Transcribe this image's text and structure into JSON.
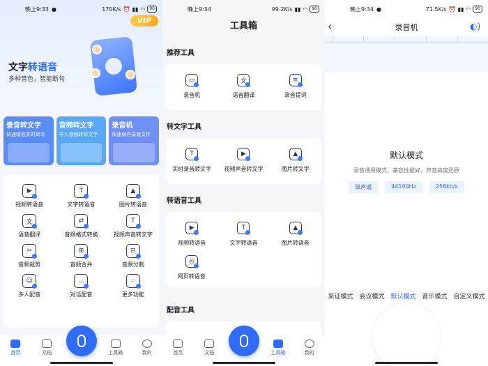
{
  "status1": {
    "time": "晚上9:33",
    "speed": "170K/s",
    "battery": "90"
  },
  "status2": {
    "time": "晚上9:34",
    "speed": "99.2K/s",
    "battery": "90"
  },
  "status3": {
    "time": "晚上9:34",
    "speed": "71.5K/s",
    "battery": "90"
  },
  "home": {
    "vip": "VIP",
    "hero_title_a": "文字",
    "hero_title_b": "转语音",
    "hero_sub": "多种音色，智能断句",
    "features": [
      {
        "title": "录音转文字",
        "sub": "快速精准实时转写",
        "color": "#5a8cf8"
      },
      {
        "title": "音频转文字",
        "sub": "导入音频转写文字",
        "color": "#58a8f5"
      },
      {
        "title": "录音机",
        "sub": "快速保存录音文件",
        "color": "#6f8ff4"
      }
    ],
    "grid": [
      {
        "label": "视频转语音",
        "icon": "▶"
      },
      {
        "label": "文字转语音",
        "icon": "T"
      },
      {
        "label": "图片转语音",
        "icon": "▲"
      },
      {
        "label": "语音翻译",
        "icon": "文"
      },
      {
        "label": "音频格式转换",
        "icon": "⇄"
      },
      {
        "label": "视频声音转文字",
        "icon": "T"
      },
      {
        "label": "音频裁剪",
        "icon": "✂"
      },
      {
        "label": "音频合并",
        "icon": "⊞"
      },
      {
        "label": "音频分割",
        "icon": "⊟"
      },
      {
        "label": "多人配音",
        "icon": "☺"
      },
      {
        "label": "对话配音",
        "icon": "…"
      },
      {
        "label": "更多功能",
        "icon": "⁘"
      }
    ]
  },
  "nav": {
    "home": "首页",
    "docs": "文档",
    "toolbox": "工具箱",
    "mine": "我的"
  },
  "toolbox": {
    "title": "工具箱",
    "sections": [
      {
        "title": "推荐工具",
        "items": [
          {
            "label": "录音机",
            "icon": "▭"
          },
          {
            "label": "语音翻译",
            "icon": "文"
          },
          {
            "label": "录音提词",
            "icon": "≡"
          }
        ]
      },
      {
        "title": "转文字工具",
        "items": [
          {
            "label": "实时录音转文字",
            "icon": "T"
          },
          {
            "label": "视频声音转文字",
            "icon": "▶"
          },
          {
            "label": "图片转文字",
            "icon": "▲"
          }
        ]
      },
      {
        "title": "转语音工具",
        "items": [
          {
            "label": "视频转语音",
            "icon": "▶"
          },
          {
            "label": "文字转语音",
            "icon": "T"
          },
          {
            "label": "图片转语音",
            "icon": "▲"
          },
          {
            "label": "网页转语音",
            "icon": "◎"
          }
        ]
      },
      {
        "title": "配音工具",
        "items": []
      }
    ]
  },
  "recorder": {
    "title": "录音机",
    "mode_title": "默认模式",
    "mode_desc": "录音通用模式，兼容性最好，声音高度还原",
    "chips": [
      "单声道",
      "44100Hz",
      "256kb/s"
    ],
    "modes": [
      "采证模式",
      "会议模式",
      "默认模式",
      "音乐模式",
      "自定义模式"
    ],
    "active_mode": "默认模式"
  }
}
